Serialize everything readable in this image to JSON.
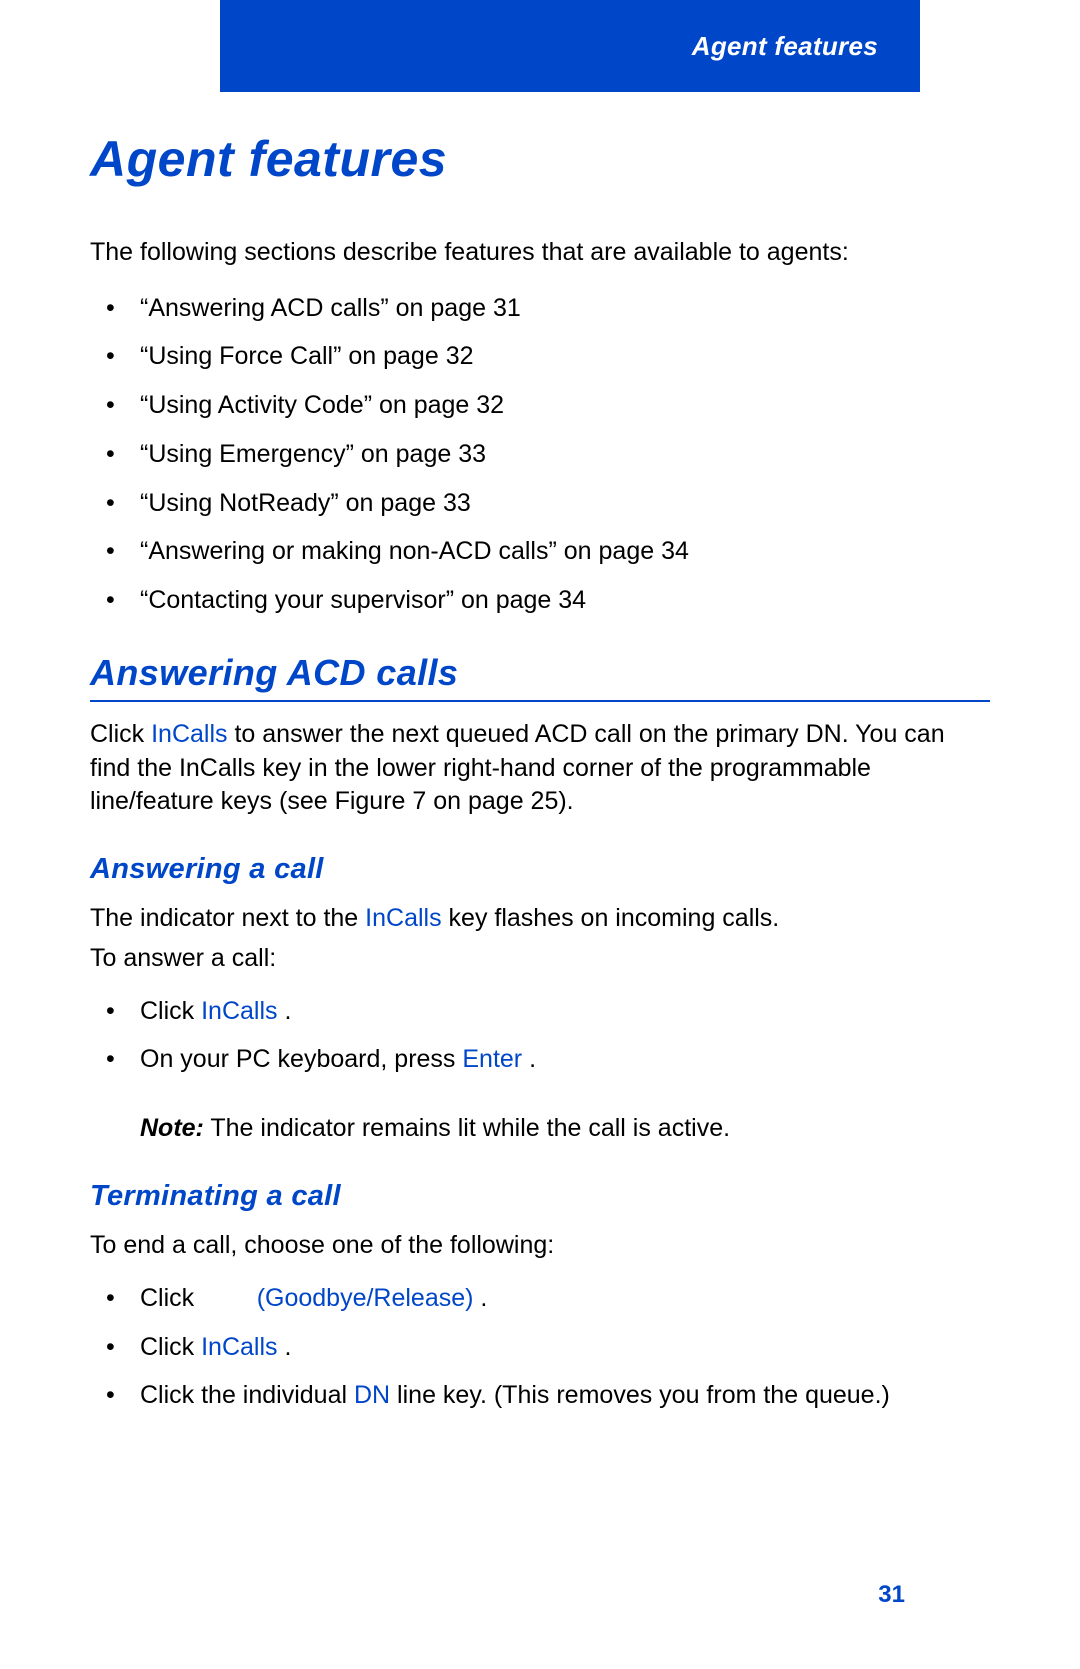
{
  "header": {
    "label": "Agent features"
  },
  "title": "Agent features",
  "intro": "The following sections describe features that are available to agents:",
  "toc": [
    "“Answering ACD calls” on page 31",
    "“Using Force Call” on page 32",
    "“Using Activity Code” on page 32",
    "“Using Emergency” on page 33",
    "“Using NotReady” on page 33",
    "“Answering or making non-ACD calls” on page 34",
    "“Contacting your supervisor” on page 34"
  ],
  "s1": {
    "heading": "Answering ACD calls",
    "p1a": "Click ",
    "p1_key": "InCalls",
    "p1b": " to answer the next queued ACD call on the primary DN. You can find the InCalls key in the lower right-hand corner of the programmable line/feature keys (see Figure 7 on page 25)."
  },
  "s2": {
    "heading": "Answering a call",
    "p1a": "The indicator next to the ",
    "p1_key": "InCalls",
    "p1b": " key flashes on incoming calls.",
    "p2": "To answer a call:",
    "b1a": "Click ",
    "b1_key": "InCalls",
    "b1b": " .",
    "b2a": "On your PC keyboard, press ",
    "b2_key": "Enter",
    "b2b": " .",
    "note_label": "Note:",
    "note_text": " The indicator remains lit while the call is active."
  },
  "s3": {
    "heading": "Terminating a call",
    "p1": "To end a call, choose one of the following:",
    "b1a": "Click ",
    "b1_key": "(Goodbye/Release)",
    "b1b": " .",
    "b2a": "Click ",
    "b2_key": "InCalls",
    "b2b": " .",
    "b3a": "Click the individual ",
    "b3_key": "DN",
    "b3b": " line key. (This removes you from the queue.)"
  },
  "page_number": "31"
}
